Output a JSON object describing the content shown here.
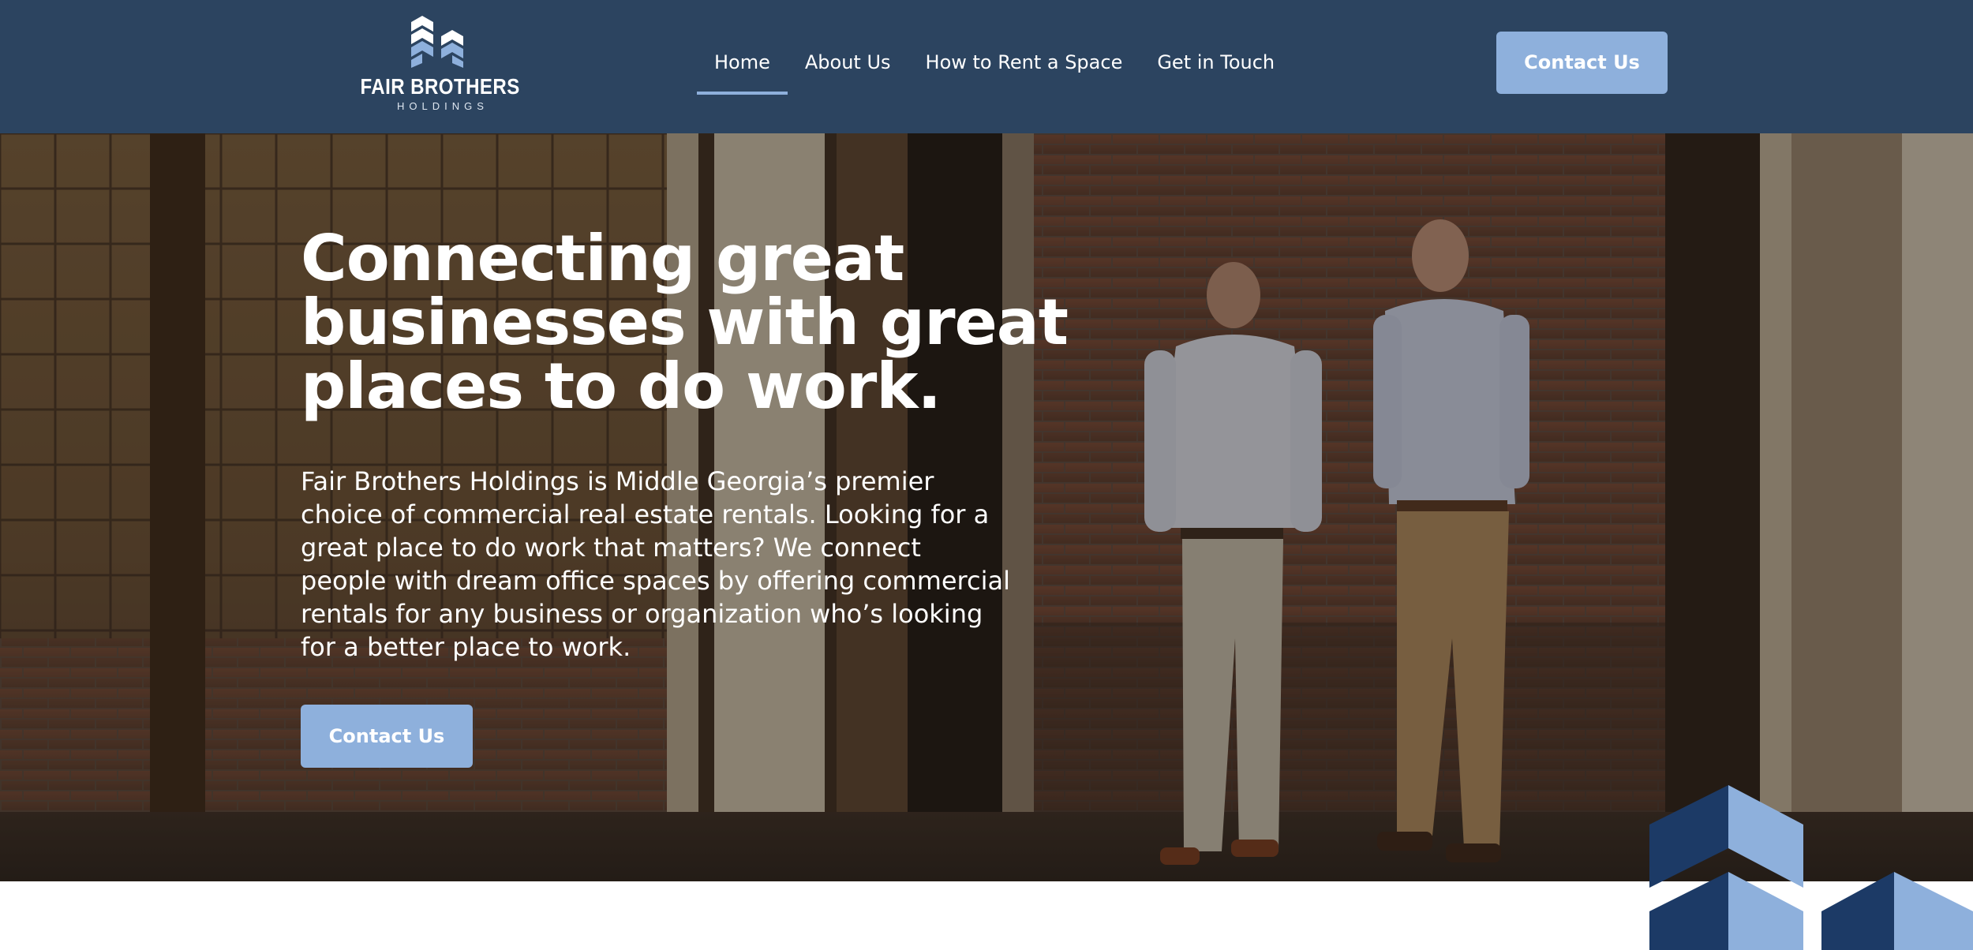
{
  "header": {
    "logo": {
      "title": "FAIR BROTHERS",
      "subtitle": "HOLDINGS",
      "icon": "building-chevrons-logo"
    },
    "nav": [
      {
        "label": "Home",
        "active": true
      },
      {
        "label": "About Us",
        "active": false
      },
      {
        "label": "How to Rent a Space",
        "active": false
      },
      {
        "label": "Get in Touch",
        "active": false
      }
    ],
    "cta_label": "Contact Us"
  },
  "hero": {
    "heading": "Connecting great businesses with great places to do work.",
    "body": "Fair Brothers Holdings is Middle Georgia’s premier choice of commercial real estate rentals. Looking for a great place to do work that matters? We connect people with dream office spaces by offering commercial rentals for any business or organization who’s looking for a better place to work.",
    "cta_label": "Contact Us",
    "background_photo": "two men standing in front of an old brick building"
  },
  "colors": {
    "header_bg": "#2c4460",
    "accent": "#8eb0dc",
    "navy": "#1c3a66",
    "text_light": "#ffffff"
  }
}
